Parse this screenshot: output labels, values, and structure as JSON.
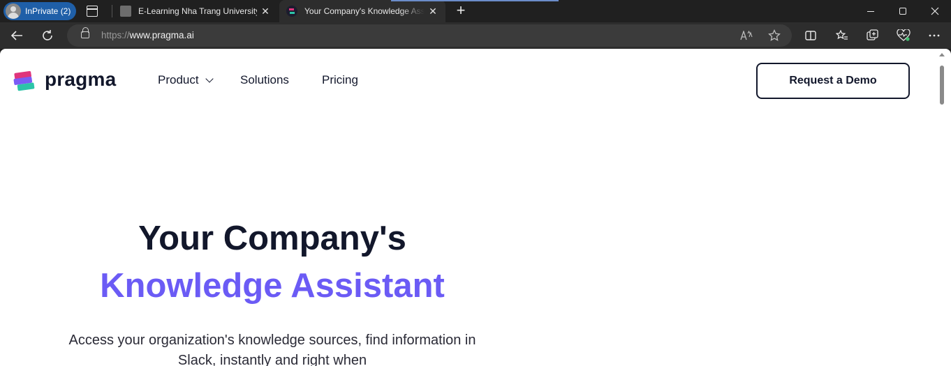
{
  "browser": {
    "inprivate_label": "InPrivate (2)",
    "tabs": [
      {
        "title": "E-Learning Nha Trang University",
        "close": "✕"
      },
      {
        "title": "Your Company's Knowledge Assistant",
        "close": "✕"
      }
    ],
    "new_tab": "+",
    "address": {
      "scheme": "https://",
      "host": "www.pragma.ai"
    }
  },
  "site": {
    "brand": "pragma",
    "nav": {
      "product": "Product",
      "solutions": "Solutions",
      "pricing": "Pricing"
    },
    "cta": "Request a Demo",
    "hero": {
      "title_line1": "Your Company's",
      "title_line2": "Knowledge Assistant",
      "subtitle": "Access your organization's knowledge sources, find information in Slack, instantly and right when"
    },
    "colors": {
      "accent": "#6b5bf5",
      "text_dark": "#12172b",
      "logo_pink": "#e0357c",
      "logo_purple": "#7a5cf5",
      "logo_teal": "#2cc4a8"
    }
  }
}
